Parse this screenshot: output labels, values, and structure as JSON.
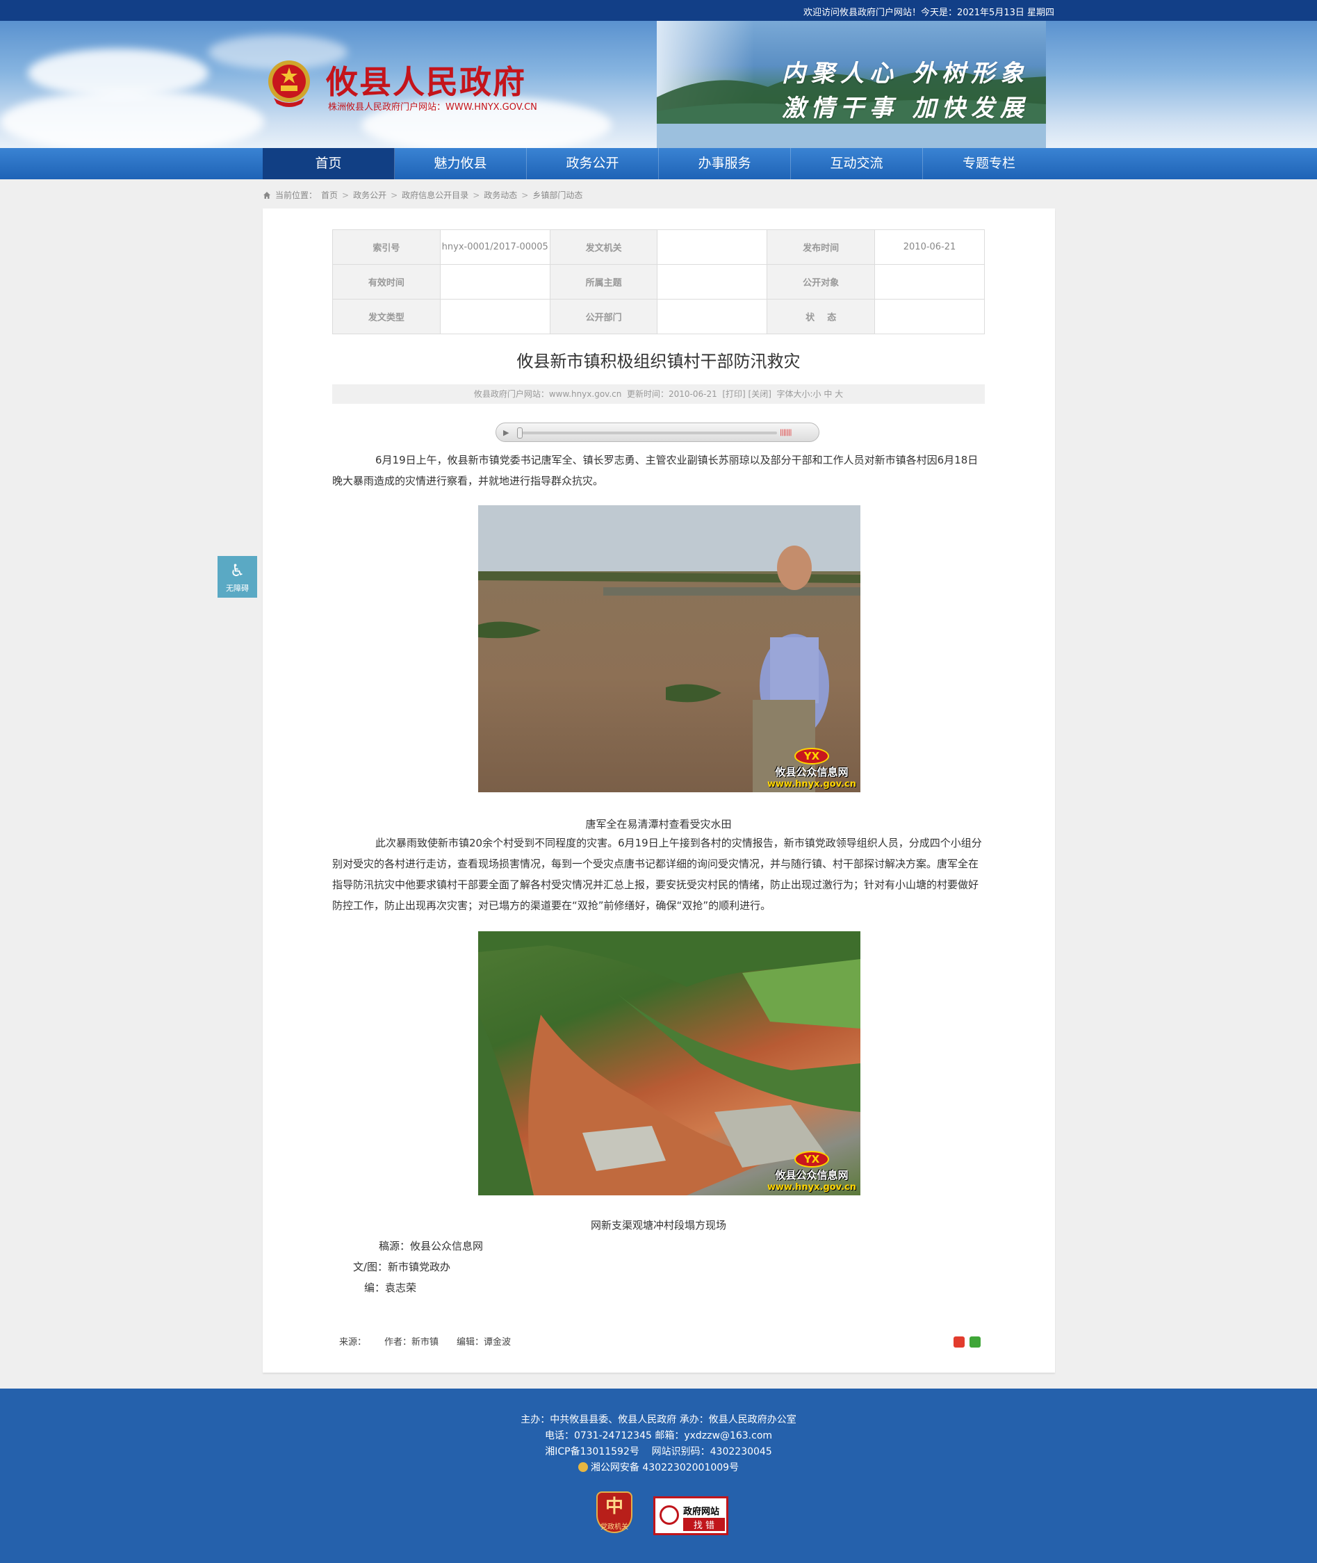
{
  "topbar": {
    "welcome": "欢迎访问攸县政府门户网站！今天是：2021年5月13日 星期四"
  },
  "header": {
    "title": "攸县人民政府",
    "subtitle": "株洲攸县人民政府门户网站：WWW.HNYX.GOV.CN",
    "slogan_1": "内聚人心  外树形象",
    "slogan_2": "激情干事  加快发展"
  },
  "nav": {
    "items": [
      "首页",
      "魅力攸县",
      "政务公开",
      "办事服务",
      "互动交流",
      "专题专栏"
    ]
  },
  "breadcrumb": {
    "label": "当前位置：",
    "items": [
      "首页",
      "政务公开",
      "政府信息公开目录",
      "政务动态",
      "乡镇部门动态"
    ]
  },
  "meta": {
    "index_label": "索引号",
    "index_value": "hnyx-0001/2017-00005",
    "issuer_label": "发文机关",
    "issuer_value": "",
    "date_label": "发布时间",
    "date_value": "2010-06-21",
    "valid_label": "有效时间",
    "valid_value": "",
    "topic_label": "所属主题",
    "topic_value": "",
    "audience_label": "公开对象",
    "audience_value": "",
    "type_label": "发文类型",
    "type_value": "",
    "dept_label": "公开部门",
    "dept_value": "",
    "status_label": "状    态",
    "status_value": ""
  },
  "article": {
    "title": "攸县新市镇积极组织镇村干部防汛救灾",
    "info": "攸县政府门户网站：www.hnyx.gov.cn  更新时间：2010-06-21  [打印] [关闭]  字体大小:小 中 大",
    "para_1": "6月19日上午，攸县新市镇党委书记唐军全、镇长罗志勇、主管农业副镇长苏丽琼以及部分干部和工作人员对新市镇各村因6月18日晚大暴雨造成的灾情进行察看，并就地进行指导群众抗灾。",
    "caption_1": "唐军全在易清潭村查看受灾水田",
    "para_2": "此次暴雨致使新市镇20余个村受到不同程度的灾害。6月19日上午接到各村的灾情报告，新市镇党政领导组织人员，分成四个小组分别对受灾的各村进行走访，查看现场损害情况，每到一个受灾点唐书记都详细的询问受灾情况，并与随行镇、村干部探讨解决方案。唐军全在指导防汛抗灾中他要求镇村干部要全面了解各村受灾情况并汇总上报，要安抚受灾村民的情绪，防止出现过激行为；针对有小山塘的村要做好防控工作，防止出现再次灾害；对已塌方的渠道要在“双抢”前修缮好，确保“双抢”的顺利进行。",
    "caption_2": "网新支渠观塘冲村段塌方现场",
    "watermark_logo": "YX",
    "watermark_name": "攸县公众信息网",
    "watermark_url": "www.hnyx.gov.cn",
    "credit_source": "稿源：攸县公众信息网",
    "credit_author": "文/图：新市镇党政办",
    "credit_editor": "编：袁志荣"
  },
  "footer_meta": {
    "source": "来源：",
    "author": "作者：新市镇",
    "editor": "编辑：谭金波"
  },
  "accessibility": {
    "label": "无障碍"
  },
  "footer": {
    "line_1": "主办：中共攸县县委、攸县人民政府 承办：攸县人民政府办公室",
    "line_2": "电话：0731-24712345 邮箱：yxdzzw@163.com",
    "line_3": "湘ICP备13011592号    网站识别码：4302230045",
    "line_4": "湘公网安备 43022302001009号",
    "badge_1": "党政机关",
    "badge_2_top": "政府网站",
    "badge_2_bottom": "找 错"
  },
  "colors": {
    "brand_red": "#c4141b",
    "nav_blue": "#1e63b6",
    "nav_active": "#113f84",
    "footer_blue": "#2561ac"
  }
}
